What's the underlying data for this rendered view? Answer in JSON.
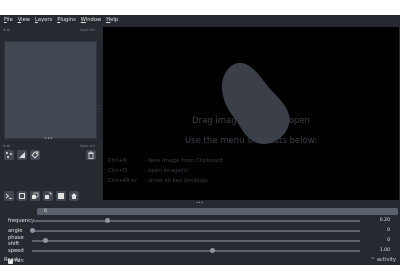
{
  "menu": [
    {
      "mnemonic": "F",
      "rest": "ile"
    },
    {
      "mnemonic": "V",
      "rest": "iew"
    },
    {
      "mnemonic": "L",
      "rest": "ayers"
    },
    {
      "mnemonic": "P",
      "rest": "lugins"
    },
    {
      "mnemonic": "W",
      "rest": "indow"
    },
    {
      "mnemonic": "H",
      "rest": "elp"
    }
  ],
  "layer_list_header": "layer list",
  "layer_controls_header": "layer ctrl",
  "welcome": {
    "line1": "Drag image(s) here to open",
    "line2": "or",
    "line3": "Use the menu shortcuts below:"
  },
  "shortcuts": [
    {
      "key": "Ctrl+N",
      "action": "New Image from Clipboard"
    },
    {
      "key": "Ctrl+O",
      "action": "open image(s)"
    },
    {
      "key": "Ctrl+Alt+/",
      "action": "show all key bindings"
    }
  ],
  "dims_slider_value": "0",
  "params": [
    {
      "label": "frequency",
      "value": "0.20",
      "position": 0.23
    },
    {
      "label": "angle",
      "value": "0",
      "position": 0.0
    },
    {
      "label": "phase shift",
      "value": "0",
      "position": 0.04
    },
    {
      "label": "speed",
      "value": "1.00",
      "position": 0.55
    }
  ],
  "run": {
    "label": "run",
    "checked": true
  },
  "status": {
    "text": "Ready",
    "activity": "activity"
  },
  "colors": {
    "background": "#262930",
    "canvas": "#000000",
    "blob": "#3b3f48"
  }
}
